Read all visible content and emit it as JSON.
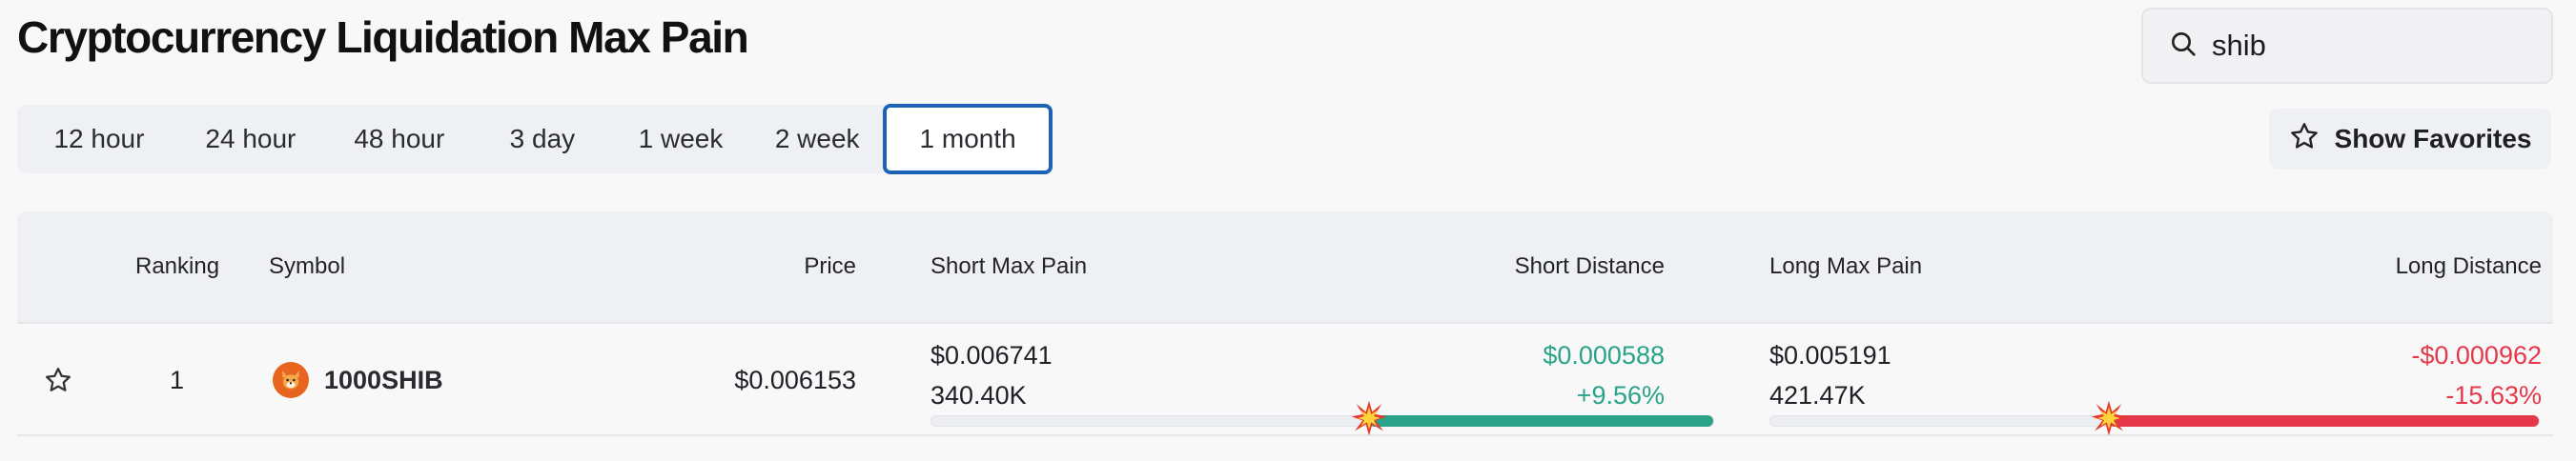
{
  "page": {
    "title": "Cryptocurrency Liquidation Max Pain"
  },
  "search": {
    "value": "shib",
    "icon": "search-icon"
  },
  "tabs": [
    {
      "label": "12 hour",
      "active": false
    },
    {
      "label": "24 hour",
      "active": false
    },
    {
      "label": "48 hour",
      "active": false
    },
    {
      "label": "3 day",
      "active": false
    },
    {
      "label": "1 week",
      "active": false
    },
    {
      "label": "2 week",
      "active": false
    },
    {
      "label": "1 month",
      "active": true
    }
  ],
  "favorites_button": {
    "label": "Show Favorites",
    "icon": "star-outline-icon"
  },
  "table": {
    "headers": {
      "ranking": "Ranking",
      "symbol": "Symbol",
      "price": "Price",
      "short_max_pain": "Short Max Pain",
      "short_distance": "Short Distance",
      "long_max_pain": "Long Max Pain",
      "long_distance": "Long Distance"
    },
    "rows": [
      {
        "rank": "1",
        "symbol": "1000SHIB",
        "coin_icon": "shib-coin-icon",
        "price": "$0.006153",
        "short_max_pain_price": "$0.006741",
        "short_max_pain_amount": "340.40K",
        "short_distance_value": "$0.000588",
        "short_distance_percent": "+9.56%",
        "short_bar_fill_fraction": 0.44,
        "long_max_pain_price": "$0.005191",
        "long_max_pain_amount": "421.47K",
        "long_distance_value": "-$0.000962",
        "long_distance_percent": "-15.63%",
        "long_bar_fill_fraction": 0.56
      }
    ]
  },
  "colors": {
    "accent_blue": "#1c63b8",
    "positive_green": "#2aa389",
    "negative_red": "#e5384a",
    "burst_icon": "explosion-burst-icon"
  }
}
